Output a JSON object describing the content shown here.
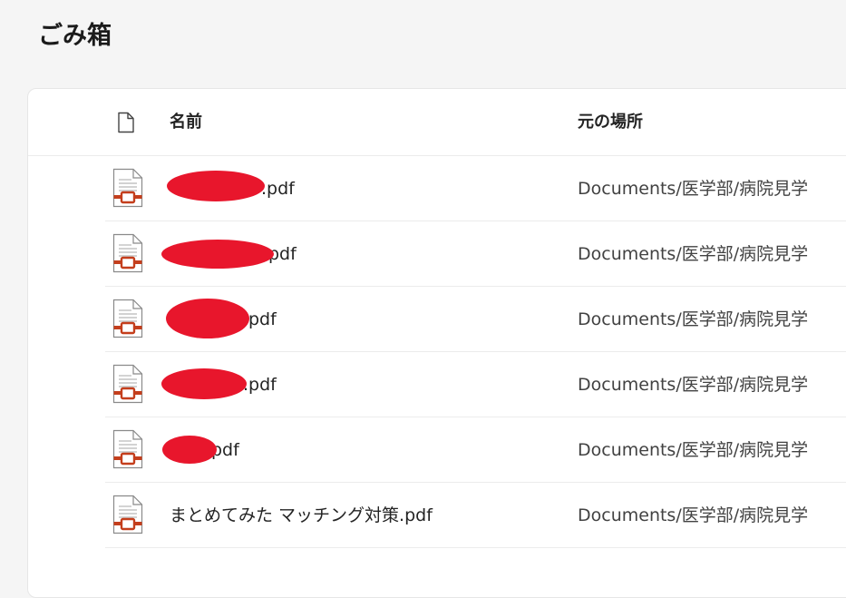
{
  "page": {
    "title": "ごみ箱"
  },
  "table": {
    "columns": {
      "type_icon": "file-icon",
      "name": "名前",
      "location": "元の場所"
    },
    "rows": [
      {
        "name": ".pdf",
        "location": "Documents/医学部/病院見学",
        "icon": "pdf-file-icon",
        "redacted": true
      },
      {
        "name": "pdf",
        "location": "Documents/医学部/病院見学",
        "icon": "pdf-file-icon",
        "redacted": true
      },
      {
        "name": "pdf",
        "location": "Documents/医学部/病院見学",
        "icon": "pdf-file-icon",
        "redacted": true
      },
      {
        "name": ".pdf",
        "location": "Documents/医学部/病院見学",
        "icon": "pdf-file-icon",
        "redacted": true
      },
      {
        "name": "pdf",
        "location": "Documents/医学部/病院見学",
        "icon": "pdf-file-icon",
        "redacted": true
      },
      {
        "name": "まとめてみた マッチング対策.pdf",
        "location": "Documents/医学部/病院見学",
        "icon": "pdf-file-icon",
        "redacted": false
      }
    ]
  },
  "colors": {
    "redaction": "#e8162c",
    "pdf_accent": "#c43e1c"
  }
}
